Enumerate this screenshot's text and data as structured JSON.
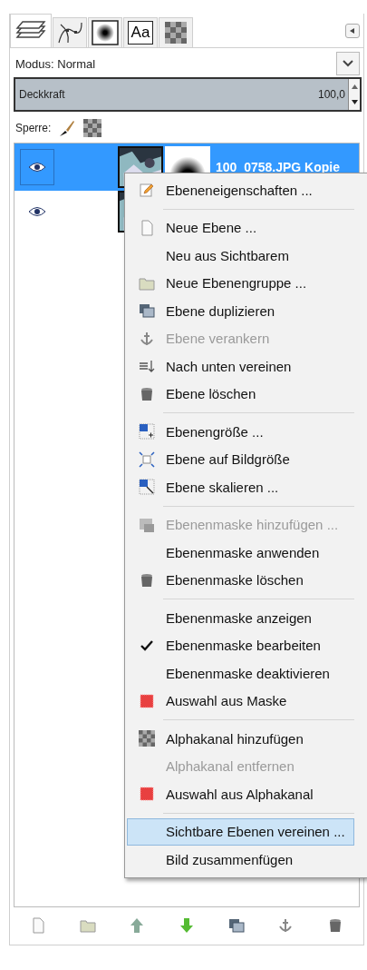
{
  "tabs": [
    {
      "kind": "layers",
      "selected": true
    },
    {
      "kind": "paths",
      "selected": false
    },
    {
      "kind": "brush",
      "selected": false
    },
    {
      "kind": "text",
      "label": "Aa",
      "selected": false
    },
    {
      "kind": "pattern",
      "selected": false
    }
  ],
  "mode": {
    "label": "Modus: Normal"
  },
  "opacity": {
    "label": "Deckkraft",
    "value": "100,0",
    "level": 1
  },
  "lock": {
    "label": "Sperre:"
  },
  "layers": [
    {
      "name": "100_0758.JPG Kopie",
      "visible": true,
      "selected": true,
      "mask": true
    },
    {
      "visible": true,
      "selected": false
    }
  ],
  "context_menu": [
    {
      "kind": "item",
      "label": "Ebeneneigenschaften ...",
      "disabled": false,
      "checked": false,
      "selected": false
    },
    {
      "kind": "separator"
    },
    {
      "kind": "item",
      "label": "Neue Ebene ...",
      "disabled": false,
      "checked": false,
      "selected": false
    },
    {
      "kind": "item",
      "label": "Neu aus Sichtbarem",
      "disabled": false,
      "checked": false,
      "selected": false
    },
    {
      "kind": "item",
      "label": "Neue Ebenengruppe ...",
      "disabled": false,
      "checked": false,
      "selected": false
    },
    {
      "kind": "item",
      "label": "Ebene duplizieren",
      "disabled": false,
      "checked": false,
      "selected": false
    },
    {
      "kind": "item",
      "label": "Ebene verankern",
      "disabled": true,
      "checked": false,
      "selected": false
    },
    {
      "kind": "item",
      "label": "Nach unten vereinen",
      "disabled": false,
      "checked": false,
      "selected": false
    },
    {
      "kind": "item",
      "label": "Ebene löschen",
      "disabled": false,
      "checked": false,
      "selected": false
    },
    {
      "kind": "separator"
    },
    {
      "kind": "item",
      "label": "Ebenengröße ...",
      "disabled": false,
      "checked": false,
      "selected": false
    },
    {
      "kind": "item",
      "label": "Ebene auf Bildgröße",
      "disabled": false,
      "checked": false,
      "selected": false
    },
    {
      "kind": "item",
      "label": "Ebene skalieren ...",
      "disabled": false,
      "checked": false,
      "selected": false
    },
    {
      "kind": "separator"
    },
    {
      "kind": "item",
      "label": "Ebenenmaske hinzufügen ...",
      "disabled": true,
      "checked": false,
      "selected": false
    },
    {
      "kind": "item",
      "label": "Ebenenmaske anwenden",
      "disabled": false,
      "checked": false,
      "selected": false
    },
    {
      "kind": "item",
      "label": "Ebenenmaske löschen",
      "disabled": false,
      "checked": false,
      "selected": false
    },
    {
      "kind": "separator"
    },
    {
      "kind": "item",
      "label": "Ebenenmaske anzeigen",
      "disabled": false,
      "checked": false,
      "selected": false
    },
    {
      "kind": "item",
      "label": "Ebenenmaske bearbeiten",
      "disabled": false,
      "checked": true,
      "selected": false
    },
    {
      "kind": "item",
      "label": "Ebenenmaske deaktivieren",
      "disabled": false,
      "checked": false,
      "selected": false
    },
    {
      "kind": "item",
      "label": "Auswahl aus Maske",
      "disabled": false,
      "checked": false,
      "selected": false
    },
    {
      "kind": "separator"
    },
    {
      "kind": "item",
      "label": "Alphakanal hinzufügen",
      "disabled": false,
      "checked": false,
      "selected": false
    },
    {
      "kind": "item",
      "label": "Alphakanal entfernen",
      "disabled": true,
      "checked": false,
      "selected": false
    },
    {
      "kind": "item",
      "label": "Auswahl aus Alphakanal",
      "disabled": false,
      "checked": false,
      "selected": false
    },
    {
      "kind": "separator"
    },
    {
      "kind": "item",
      "label": "Sichtbare Ebenen vereinen ...",
      "disabled": false,
      "checked": false,
      "selected": true
    },
    {
      "kind": "item",
      "label": "Bild zusammenfügen",
      "disabled": false,
      "checked": false,
      "selected": false
    }
  ],
  "toolbar": [
    {
      "kind": "page"
    },
    {
      "kind": "folder"
    },
    {
      "kind": "up"
    },
    {
      "kind": "down"
    },
    {
      "kind": "duplicate"
    },
    {
      "kind": "anchor"
    },
    {
      "kind": "trash"
    }
  ]
}
